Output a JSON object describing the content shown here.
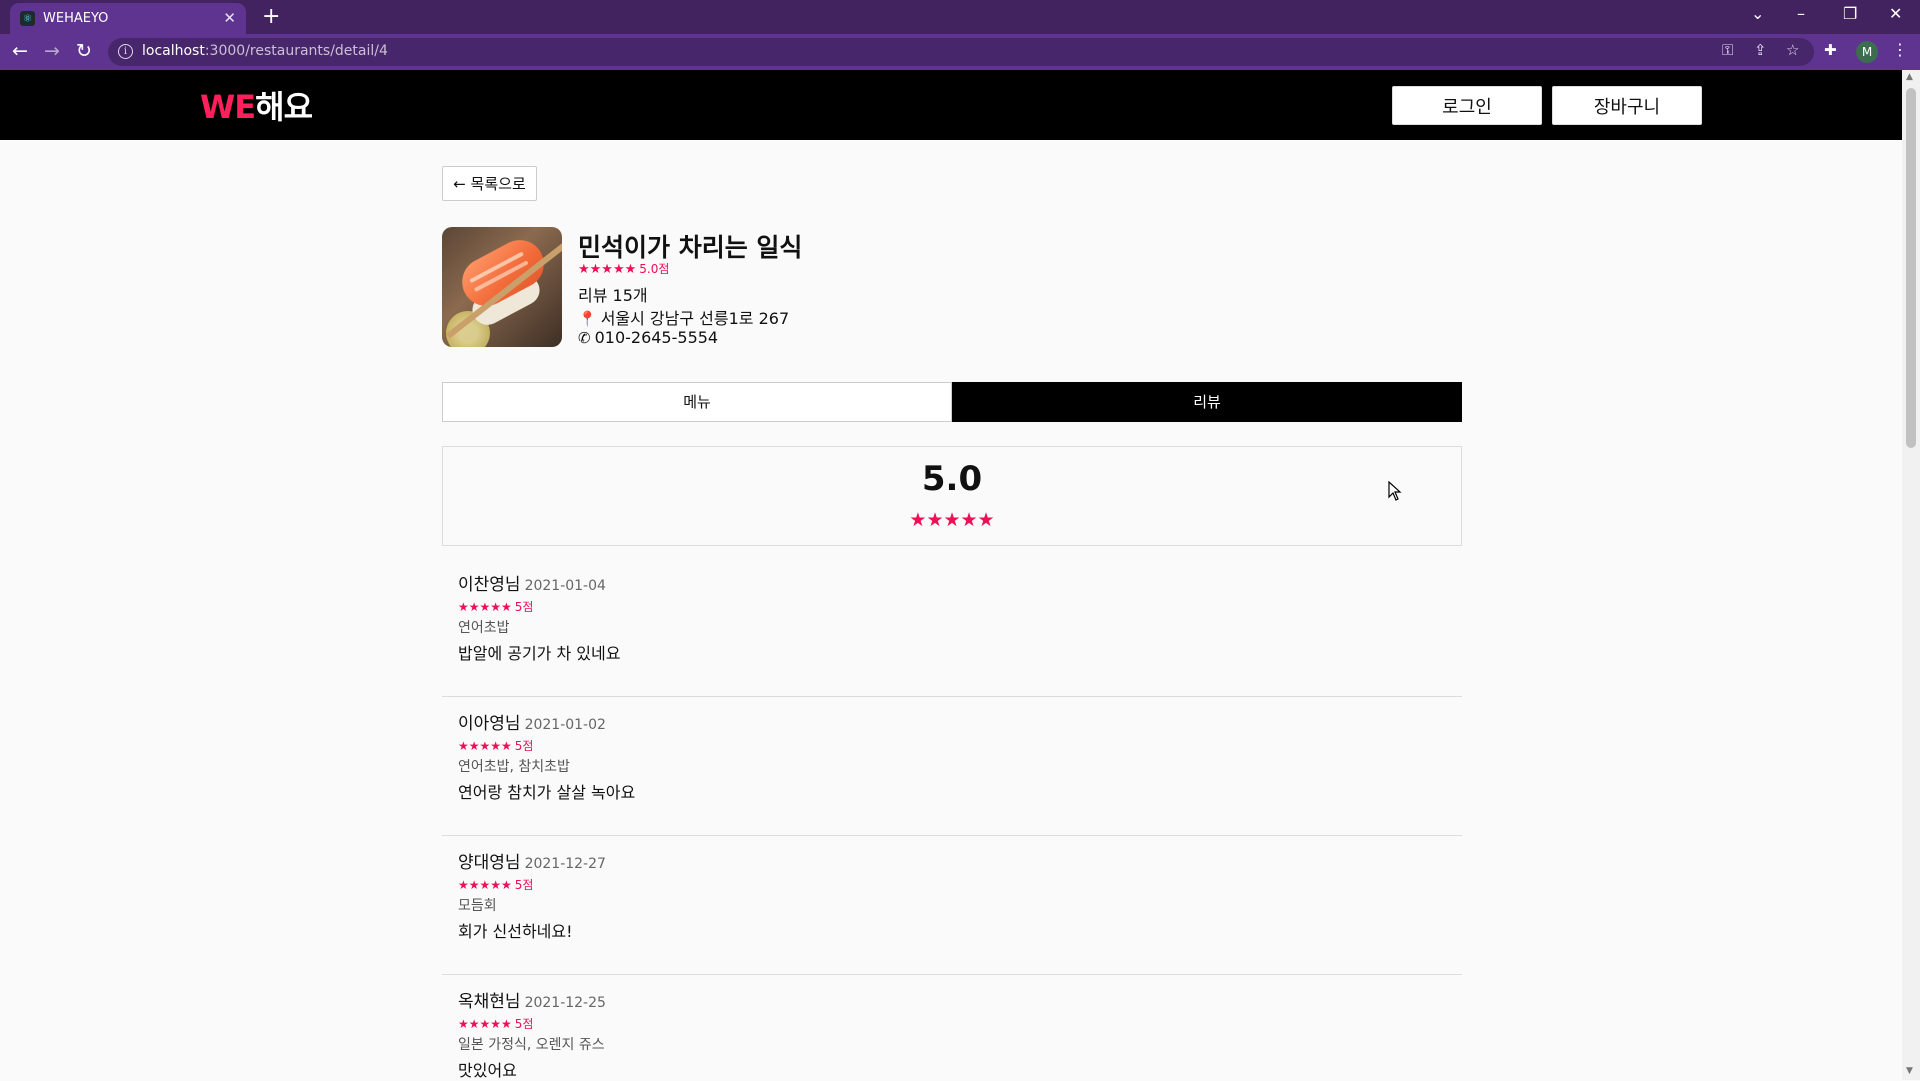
{
  "browser": {
    "tab_title": "WEHAEYO",
    "tab_close": "✕",
    "new_tab": "+",
    "url_host": "localhost",
    "url_path": ":3000/restaurants/detail/4",
    "profile_initial": "M"
  },
  "header": {
    "logo_we": "WE",
    "logo_rest": "해요",
    "login_label": "로그인",
    "cart_label": "장바구니"
  },
  "back_label": "← 목록으로",
  "restaurant": {
    "name": "민석이가 차리는 일식",
    "stars": "★★★★★",
    "rating_text": "5.0점",
    "review_count": "리뷰 15개",
    "address": "서울시 강남구 선릉1로 267",
    "phone": "010-2645-5554"
  },
  "tabs": {
    "menu": "메뉴",
    "review": "리뷰"
  },
  "summary": {
    "score": "5.0",
    "stars": "★★★★★"
  },
  "reviews": [
    {
      "name": "이찬영님",
      "date": "2021-01-04",
      "stars": "★★★★★",
      "score": "5점",
      "menu": "연어초밥",
      "text": "밥알에 공기가 차 있네요"
    },
    {
      "name": "이아영님",
      "date": "2021-01-02",
      "stars": "★★★★★",
      "score": "5점",
      "menu": "연어초밥, 참치초밥",
      "text": "연어랑 참치가 살살 녹아요"
    },
    {
      "name": "양대영님",
      "date": "2021-12-27",
      "stars": "★★★★★",
      "score": "5점",
      "menu": "모듬회",
      "text": "회가 신선하네요!"
    },
    {
      "name": "옥채현님",
      "date": "2021-12-25",
      "stars": "★★★★★",
      "score": "5점",
      "menu": "일본 가정식, 오렌지 쥬스",
      "text": "맛있어요"
    }
  ],
  "colors": {
    "chrome_dark": "#42235f",
    "chrome": "#5f3490",
    "brand_pink": "#ff1f5a",
    "star": "#ee0f57"
  }
}
